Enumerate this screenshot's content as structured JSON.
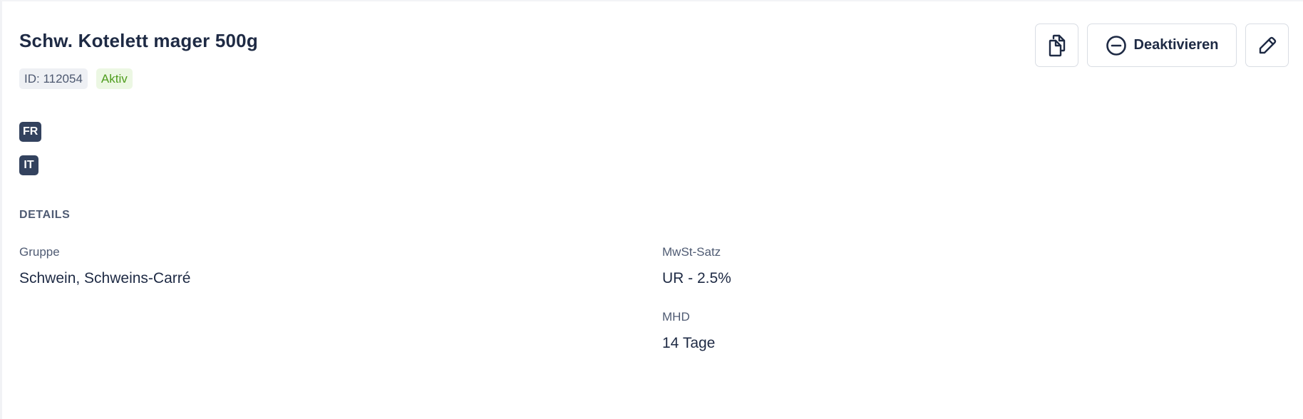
{
  "product": {
    "title": "Schw. Kotelett mager 500g",
    "id_label": "ID: 112054",
    "status": "Aktiv",
    "languages": [
      "FR",
      "IT"
    ]
  },
  "toolbar": {
    "copy_icon": "copy-documents-icon",
    "deactivate_icon": "minus-circle-icon",
    "deactivate_label": "Deaktivieren",
    "edit_icon": "pencil-icon"
  },
  "details": {
    "section_title": "DETAILS",
    "gruppe": {
      "label": "Gruppe",
      "value": "Schwein, Schweins-Carré"
    },
    "mwst": {
      "label": "MwSt-Satz",
      "value": "UR - 2.5%"
    },
    "mhd": {
      "label": "MHD",
      "value": "14 Tage"
    }
  },
  "colors": {
    "text_primary": "#1e2a44",
    "text_secondary": "#4f5b73",
    "badge_dark": "#33425e",
    "status_green": "#4f9d1e",
    "status_green_bg": "#ecf7e3"
  }
}
